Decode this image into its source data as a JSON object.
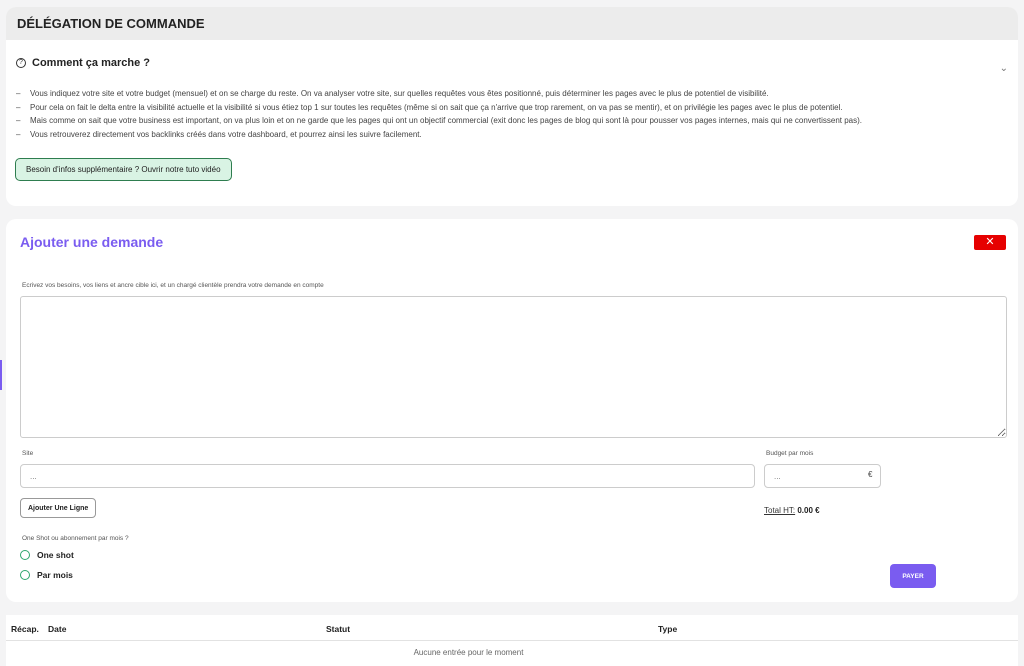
{
  "header": {
    "title": "DÉLÉGATION DE COMMANDE"
  },
  "how": {
    "title": "Comment ça marche ?",
    "bullets": [
      "Vous indiquez votre site et votre budget (mensuel) et on se charge du reste. On va analyser votre site, sur quelles requêtes vous êtes positionné, puis déterminer les pages avec le plus de potentiel de visibilité.",
      "Pour cela on fait le delta entre la visibilité actuelle et la visibilité si vous étiez top 1 sur toutes les requêtes (même si on sait que ça n'arrive que trop rarement, on va pas se mentir), et on privilégie les pages avec le plus de potentiel.",
      "Mais comme on sait que votre business est important, on va plus loin et on ne garde que les pages qui ont un objectif commercial (exit donc les pages de blog qui sont là pour pousser vos pages internes, mais qui ne convertissent pas).",
      "Vous retrouverez directement vos backlinks créés dans votre dashboard, et pourrez ainsi les suivre facilement."
    ],
    "tuto_button": "Besoin d'infos supplémentaire ? Ouvrir notre tuto vidéo"
  },
  "form": {
    "title": "Ajouter une demande",
    "close_symbol": "✕",
    "description_label": "Ecrivez vos besoins, vos liens et ancre cible ici, et un chargé clientèle prendra votre demande en compte",
    "site_label": "Site",
    "site_placeholder": "...",
    "budget_label": "Budget par mois",
    "budget_placeholder": "...",
    "currency": "€",
    "add_line_button": "Ajouter Une Ligne",
    "total_label": "Total HT:",
    "total_value": "0.00 €",
    "choice_label": "One Shot ou abonnement par mois ?",
    "options": [
      "One shot",
      "Par mois"
    ],
    "pay_button": "PAYER"
  },
  "table": {
    "columns": [
      "Récap.",
      "Date",
      "Statut",
      "Type"
    ],
    "empty_message": "Aucune entrée pour le moment"
  },
  "colors": {
    "accent": "#7a5cf0",
    "danger": "#e60000",
    "success": "#2ea66d",
    "tuto_bg": "#d9f3e4"
  }
}
